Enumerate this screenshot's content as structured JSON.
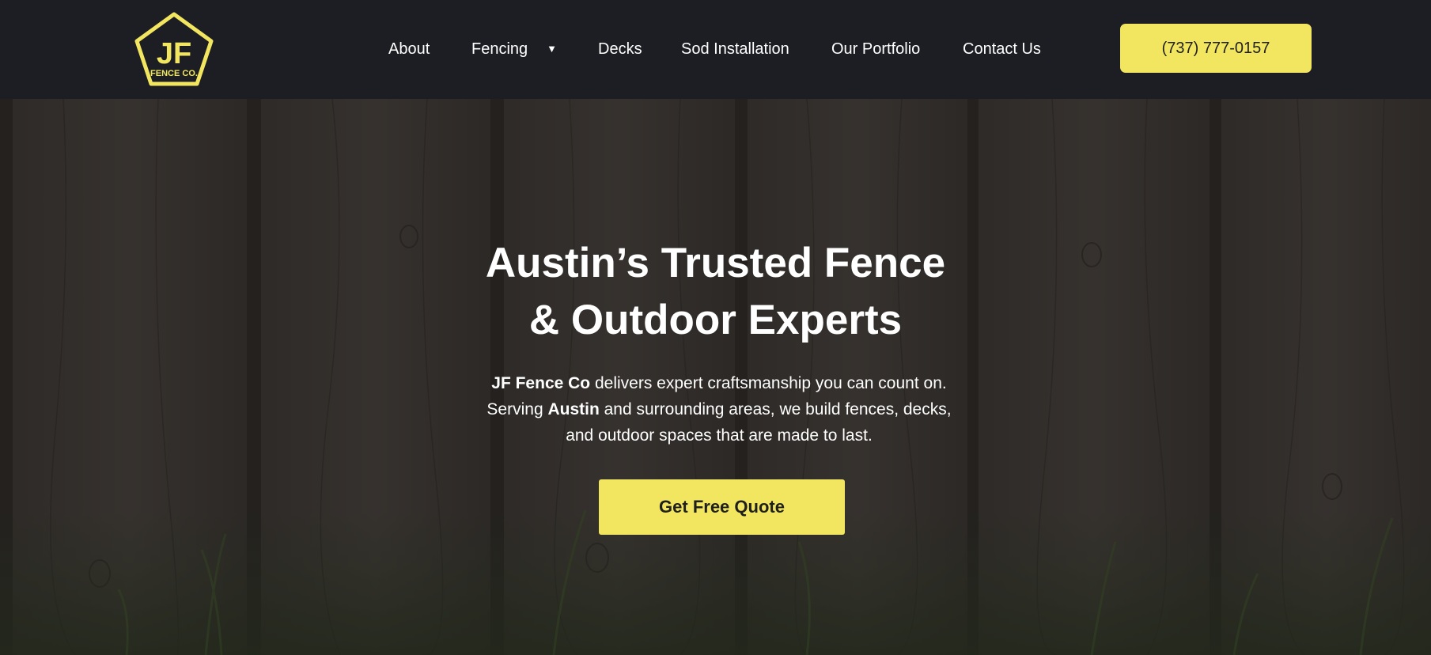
{
  "brand": {
    "logo_initials": "JF",
    "logo_subtitle": "FENCE CO.",
    "logo_color": "#f2e661"
  },
  "nav": {
    "items": [
      {
        "label": "About"
      },
      {
        "label": "Fencing",
        "has_dropdown": true,
        "caret": "▼"
      },
      {
        "label": "Decks"
      },
      {
        "label": "Sod Installation"
      },
      {
        "label": "Our Portfolio"
      },
      {
        "label": "Contact Us"
      }
    ],
    "phone_label": "(737) 777-0157"
  },
  "hero": {
    "title_line1": "Austin’s Trusted Fence",
    "title_line2": "& Outdoor Experts",
    "desc": {
      "l1_bold": "JF Fence Co",
      "l1_rest": " delivers expert craftsmanship you can count on.",
      "l2_pre": "Serving ",
      "l2_bold": "Austin",
      "l2_rest": " and surrounding areas, we build fences, decks,",
      "l3": "and outdoor spaces that are made to last."
    },
    "cta_label": "Get Free Quote"
  },
  "colors": {
    "header_bg": "#1c1e23",
    "accent": "#f2e661",
    "text_light": "#ffffff",
    "text_dark": "#1f1f1f"
  }
}
